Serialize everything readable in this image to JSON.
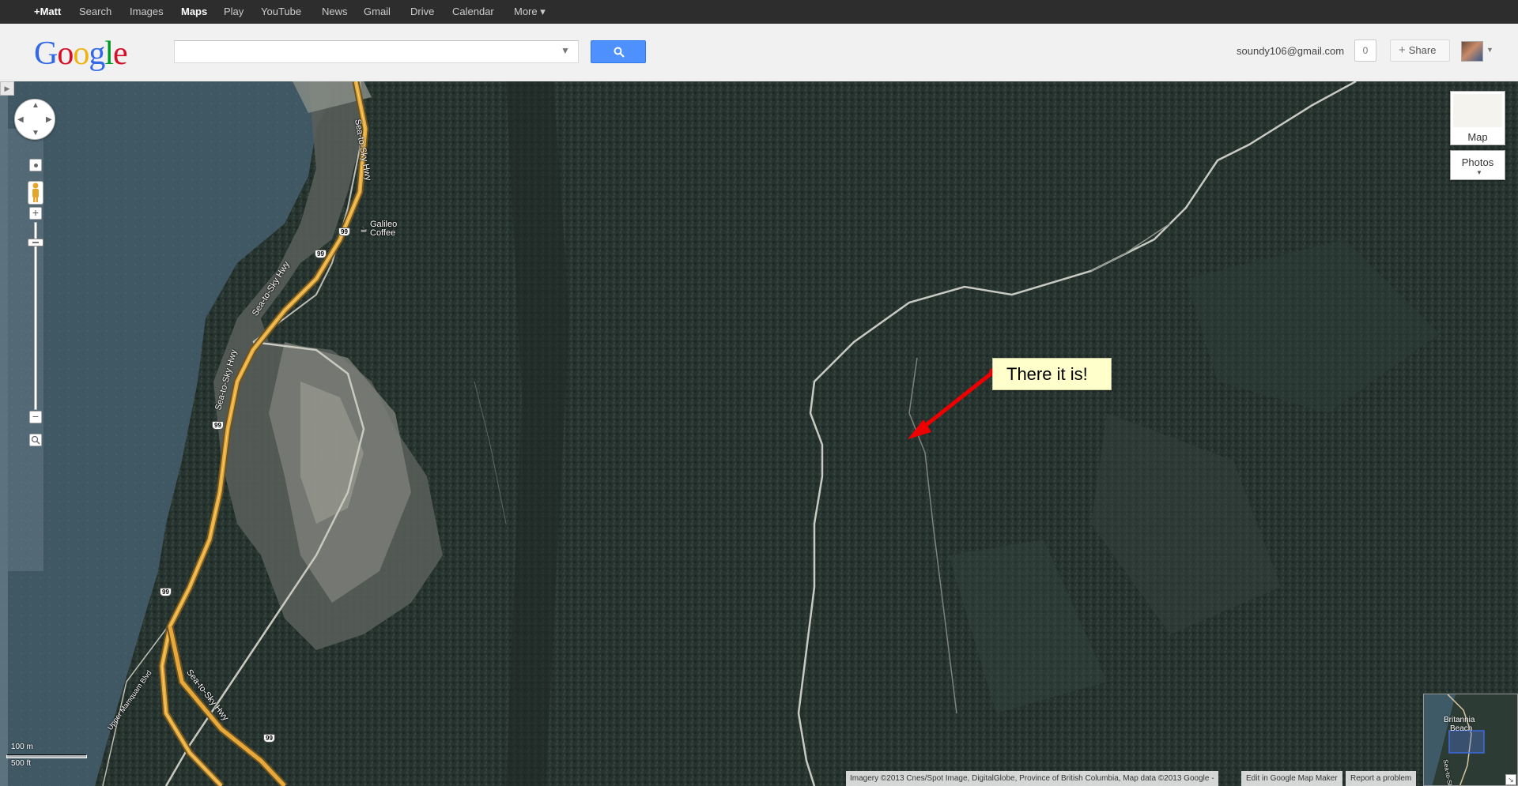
{
  "topnav": {
    "items": [
      {
        "label": "+Matt",
        "active": false
      },
      {
        "label": "Search",
        "active": false
      },
      {
        "label": "Images",
        "active": false
      },
      {
        "label": "Maps",
        "active": true
      },
      {
        "label": "Play",
        "active": false
      },
      {
        "label": "YouTube",
        "active": false
      },
      {
        "label": "News",
        "active": false
      },
      {
        "label": "Gmail",
        "active": false
      },
      {
        "label": "Drive",
        "active": false
      },
      {
        "label": "Calendar",
        "active": false
      },
      {
        "label": "More ▾",
        "active": false
      }
    ]
  },
  "header": {
    "logo": "Google",
    "search_value": "",
    "user_email": "soundy106@gmail.com",
    "notification_count": "0",
    "share_label": "Share",
    "share_icon": "plus-icon"
  },
  "map": {
    "type_buttons": {
      "map_label": "Map",
      "photos_label": "Photos"
    },
    "places": [
      {
        "name": "Galileo\nCoffee",
        "line1": "Galileo",
        "line2": "Coffee"
      }
    ],
    "roads": [
      {
        "name": "Sea-to-Sky Hwy"
      },
      {
        "name": "Upper Mamquam Blvd"
      }
    ],
    "route_shield": "99",
    "annotation": {
      "text": "There it is!",
      "arrow_color": "#ee0000"
    },
    "scale": {
      "metric": "100 m",
      "imperial": "500 ft"
    },
    "attribution": "Imagery ©2013 Cnes/Spot Image, DigitalGlobe, Province of British Columbia, Map data ©2013 Google -",
    "edit_link": "Edit in Google Map Maker",
    "report_link": "Report a problem",
    "overview": {
      "label_1": "Britannia",
      "label_2": "Beach",
      "road_label": "Sea-to-Sky Hwy"
    }
  },
  "colors": {
    "topbar_bg": "#2d2d2d",
    "header_bg": "#f1f1f1",
    "search_button": "#4d90fe",
    "forest": "#26322f",
    "water": "#3f5660",
    "highway": "#e8a93a",
    "callout_bg": "#ffffcc"
  },
  "icons": [
    "search-icon",
    "dropdown-icon",
    "pan-arrows-icon",
    "locate-icon",
    "pegman-icon",
    "zoom-in-icon",
    "zoom-out-icon",
    "zoom-box-icon",
    "plus-icon",
    "caret-icon"
  ]
}
